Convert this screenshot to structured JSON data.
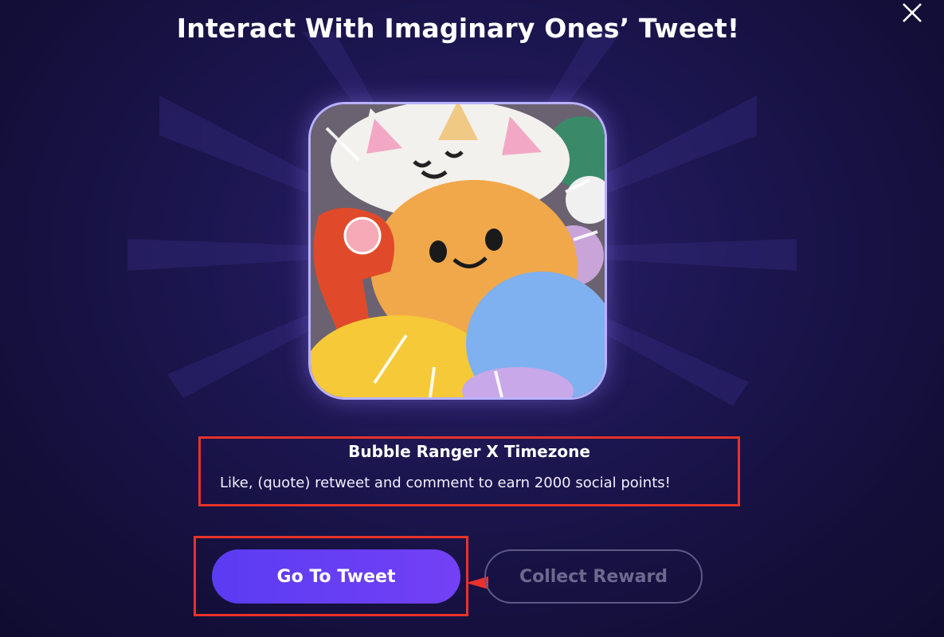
{
  "modal": {
    "title": "Interact With Imaginary Ones’ Tweet!",
    "close_icon": "close-icon"
  },
  "campaign": {
    "image_alt": "plush toys",
    "name": "Bubble Ranger X Timezone",
    "description": "Like, (quote) retweet and comment to earn 2000 social points!"
  },
  "actions": {
    "go_to_tweet": "Go To Tweet",
    "collect_reward": "Collect Reward"
  },
  "colors": {
    "background": "#1c1650",
    "primary_button": "#5a3cf2",
    "highlight_box": "#e8322a"
  }
}
